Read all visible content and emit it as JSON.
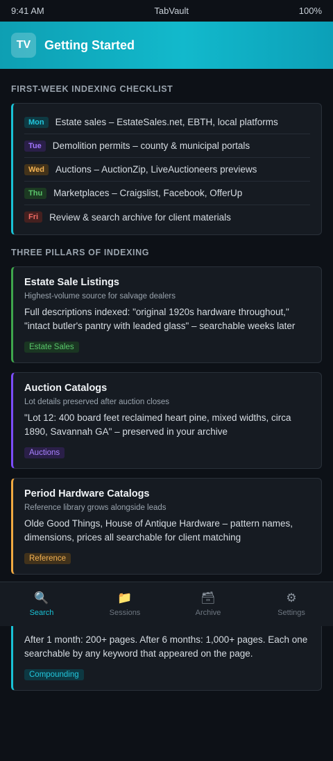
{
  "status": {
    "time": "9:41 AM",
    "app": "TabVault",
    "battery": "100%"
  },
  "header": {
    "logo": "TV",
    "title": "Getting Started"
  },
  "checklist": {
    "title": "FIRST-WEEK INDEXING CHECKLIST",
    "items": [
      {
        "day": "Mon",
        "text": "Estate sales – EstateSales.net, EBTH, local platforms"
      },
      {
        "day": "Tue",
        "text": "Demolition permits – county & municipal portals"
      },
      {
        "day": "Wed",
        "text": "Auctions – AuctionZip, LiveAuctioneers previews"
      },
      {
        "day": "Thu",
        "text": "Marketplaces – Craigslist, Facebook, OfferUp"
      },
      {
        "day": "Fri",
        "text": "Review & search archive for client materials"
      }
    ]
  },
  "pillars": {
    "title": "THREE PILLARS OF INDEXING",
    "cards": [
      {
        "title": "Estate Sale Listings",
        "subtitle": "Highest-volume source for salvage dealers",
        "body": "Full descriptions indexed: \"original 1920s hardware throughout,\" \"intact butler's pantry with leaded glass\" – searchable weeks later",
        "tag": "Estate Sales"
      },
      {
        "title": "Auction Catalogs",
        "subtitle": "Lot details preserved after auction closes",
        "body": "\"Lot 12: 400 board feet reclaimed heart pine, mixed widths, circa 1890, Savannah GA\" – preserved in your archive",
        "tag": "Auctions"
      },
      {
        "title": "Period Hardware Catalogs",
        "subtitle": "Reference library grows alongside leads",
        "body": "Olde Good Things, House of Antique Hardware – pattern names, dimensions, prices all searchable for client matching",
        "tag": "Reference"
      }
    ]
  },
  "compounding": {
    "body": "After 1 month: 200+ pages. After 6 months: 1,000+ pages. Each one searchable by any keyword that appeared on the page.",
    "tag": "Compounding"
  },
  "tabbar": {
    "items": [
      {
        "icon": "🔍",
        "label": "Search"
      },
      {
        "icon": "📁",
        "label": "Sessions"
      },
      {
        "icon": "🗃",
        "label": "Archive"
      },
      {
        "icon": "⚙",
        "label": "Settings"
      }
    ]
  }
}
